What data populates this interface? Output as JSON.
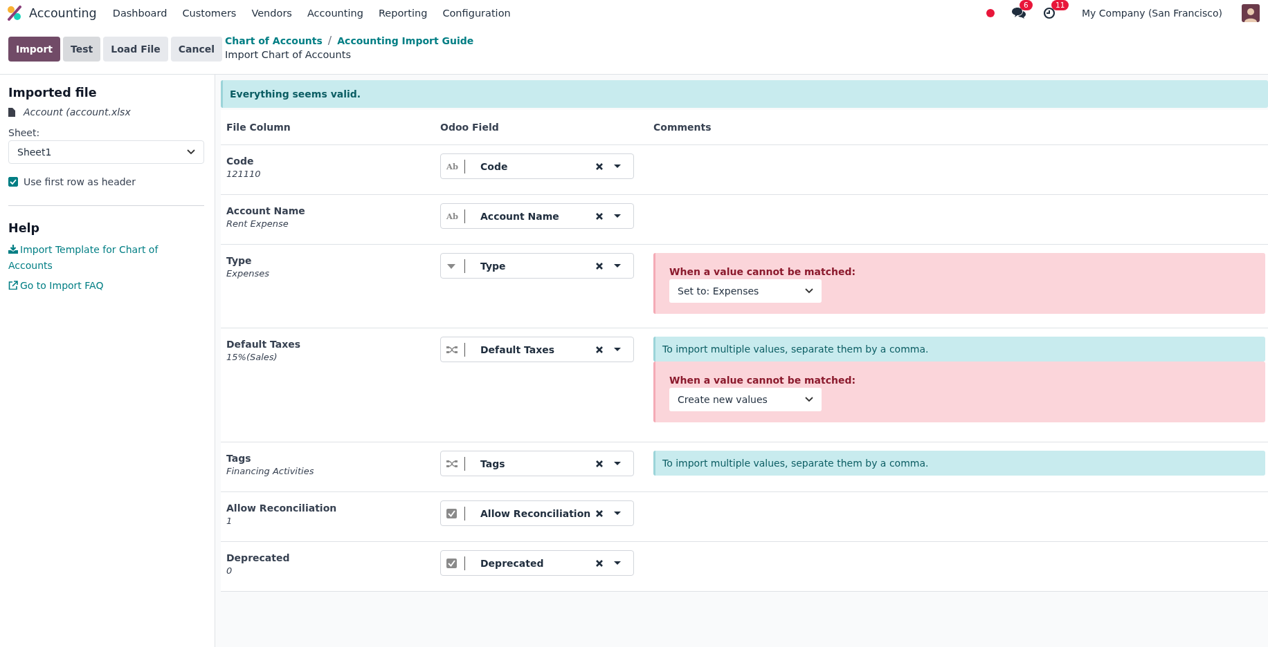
{
  "navbar": {
    "app_name": "Accounting",
    "menu": [
      "Dashboard",
      "Customers",
      "Vendors",
      "Accounting",
      "Reporting",
      "Configuration"
    ],
    "message_count": "6",
    "activity_count": "11",
    "company": "My Company (San Francisco)"
  },
  "control_panel": {
    "buttons": [
      {
        "label": "Import",
        "kind": "primary"
      },
      {
        "label": "Test",
        "kind": "secondary"
      },
      {
        "label": "Load File",
        "kind": "light"
      },
      {
        "label": "Cancel",
        "kind": "light"
      }
    ],
    "breadcrumbs": [
      "Chart of Accounts",
      "Accounting Import Guide"
    ],
    "breadcrumb_separator": "/",
    "current_page": "Import Chart of Accounts"
  },
  "sidebar": {
    "title": "Imported file",
    "file_name": "Account (account.xlsx",
    "sheet_label": "Sheet:",
    "sheet_value": "Sheet1",
    "header_option": {
      "label": "Use first row as header",
      "checked": true
    },
    "help_title": "Help",
    "help_links": [
      {
        "label": "Import Template for Chart of Accounts",
        "kind": "download"
      },
      {
        "label": "Go to Import FAQ",
        "kind": "external"
      }
    ]
  },
  "main": {
    "alert": "Everything seems valid.",
    "columns": [
      "File Column",
      "Odoo Field",
      "Comments"
    ],
    "rows": [
      {
        "column": "Code",
        "sample": "121110",
        "field": {
          "label": "Code",
          "kind": "text",
          "icon_text": "Ab"
        },
        "comments": []
      },
      {
        "column": "Account Name",
        "sample": "Rent Expense",
        "field": {
          "label": "Account Name",
          "kind": "text",
          "icon_text": "Ab"
        },
        "comments": []
      },
      {
        "column": "Type",
        "sample": "Expenses",
        "field": {
          "label": "Type",
          "kind": "selection"
        },
        "comments": [
          {
            "kind": "fallback",
            "label": "When a value cannot be matched:",
            "value": "Set to: Expenses"
          }
        ]
      },
      {
        "column": "Default Taxes",
        "sample": "15%(Sales)",
        "field": {
          "label": "Default Taxes",
          "kind": "many"
        },
        "comments": [
          {
            "kind": "info",
            "text": "To import multiple values, separate them by a comma."
          },
          {
            "kind": "fallback",
            "label": "When a value cannot be matched:",
            "value": "Create new values"
          }
        ]
      },
      {
        "column": "Tags",
        "sample": "Financing Activities",
        "field": {
          "label": "Tags",
          "kind": "many"
        },
        "comments": [
          {
            "kind": "info",
            "text": "To import multiple values, separate them by a comma."
          }
        ]
      },
      {
        "column": "Allow Reconciliation",
        "sample": "1",
        "field": {
          "label": "Allow Reconciliation",
          "kind": "boolean"
        },
        "comments": []
      },
      {
        "column": "Deprecated",
        "sample": "0",
        "field": {
          "label": "Deprecated",
          "kind": "boolean"
        },
        "comments": []
      }
    ]
  }
}
